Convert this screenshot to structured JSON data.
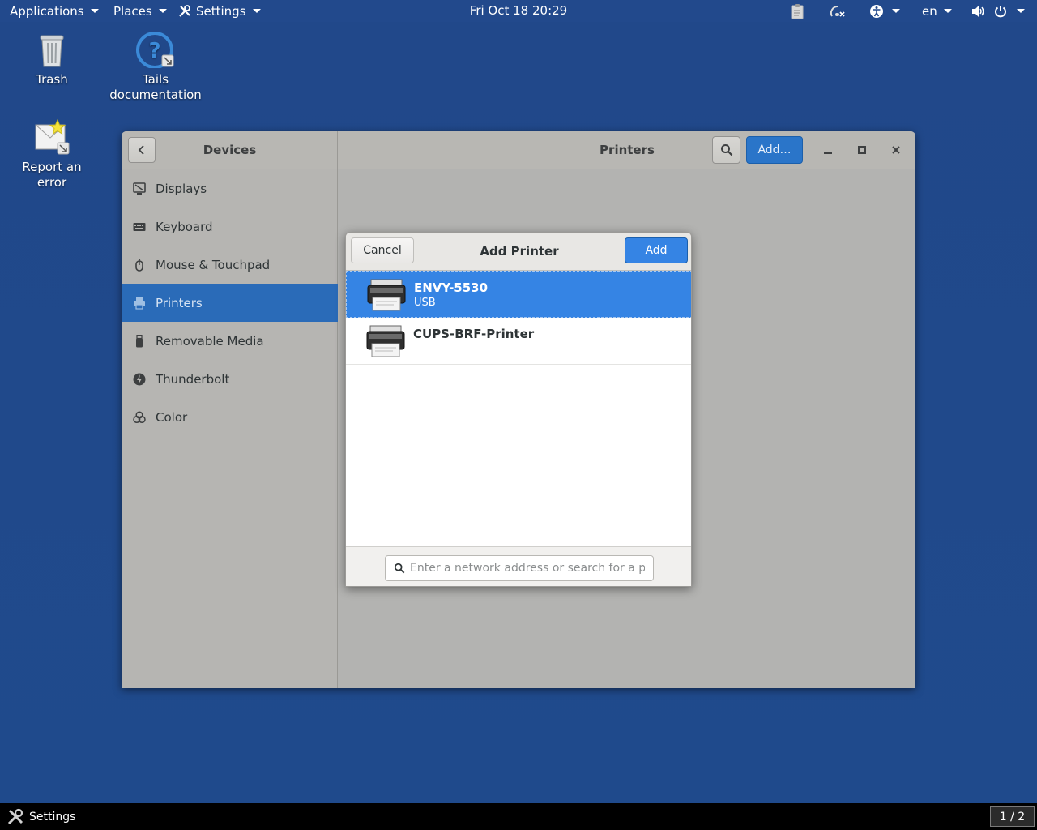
{
  "top_panel": {
    "applications": "Applications",
    "places": "Places",
    "settings": "Settings",
    "clock": "Fri Oct 18  20:29",
    "language": "en",
    "icons": [
      "clipboard-icon",
      "network-icon",
      "accessibility-icon",
      "volume-icon",
      "power-icon"
    ]
  },
  "desktop": {
    "trash": "Trash",
    "tails_doc": "Tails\ndocumentation",
    "report_error": "Report an error"
  },
  "window": {
    "sidebar_title": "Devices",
    "title": "Printers",
    "add_button": "Add…",
    "sidebar": [
      {
        "label": "Displays",
        "icon": "display-icon"
      },
      {
        "label": "Keyboard",
        "icon": "keyboard-icon"
      },
      {
        "label": "Mouse & Touchpad",
        "icon": "mouse-icon"
      },
      {
        "label": "Printers",
        "icon": "printer-icon",
        "active": true
      },
      {
        "label": "Removable Media",
        "icon": "usb-icon"
      },
      {
        "label": "Thunderbolt",
        "icon": "thunderbolt-icon"
      },
      {
        "label": "Color",
        "icon": "color-icon"
      }
    ]
  },
  "dialog": {
    "title": "Add Printer",
    "cancel": "Cancel",
    "add": "Add",
    "printers": [
      {
        "name": "ENVY-5530",
        "connection": "USB",
        "selected": true
      },
      {
        "name": "CUPS-BRF-Printer",
        "connection": ""
      }
    ],
    "search_placeholder": "Enter a network address or search for a pri…"
  },
  "taskbar": {
    "app": "Settings",
    "workspace": "1 / 2"
  },
  "colors": {
    "desktop": "#21488a",
    "accent": "#3584e4",
    "sidebar_active": "#2a6bb8"
  }
}
